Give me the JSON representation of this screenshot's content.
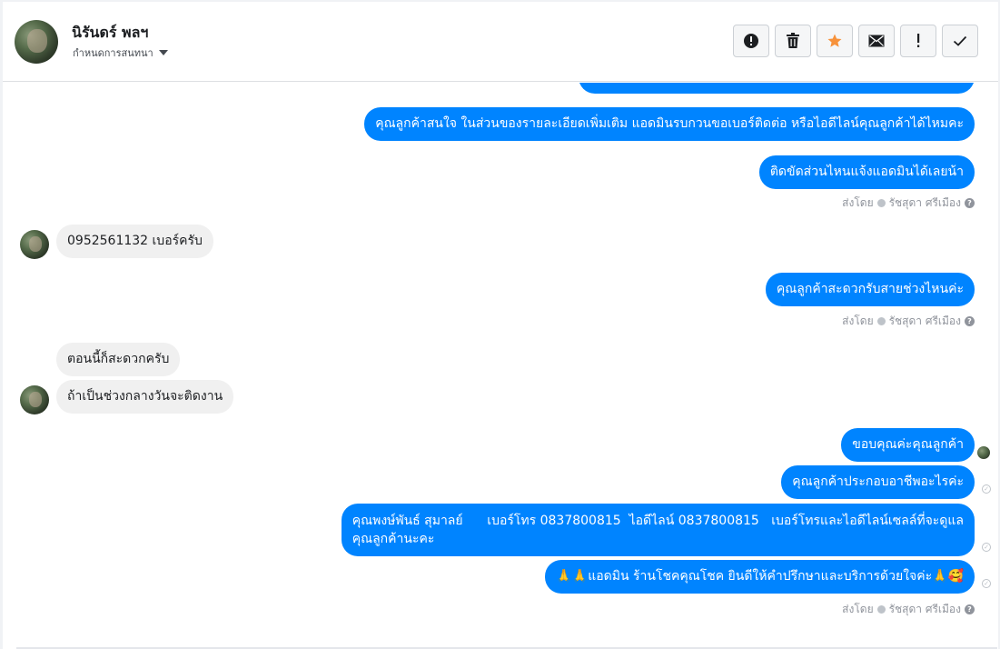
{
  "header": {
    "contact_name": "นิรันดร์ พลฯ",
    "set_conversation_label": "กำหนดการสนทนา",
    "actions": [
      {
        "name": "mark-spam-button",
        "icon": "alert-circle-icon"
      },
      {
        "name": "delete-button",
        "icon": "trash-icon"
      },
      {
        "name": "star-button",
        "icon": "star-icon"
      },
      {
        "name": "mark-unread-button",
        "icon": "envelope-icon"
      },
      {
        "name": "follow-up-button",
        "icon": "exclamation-icon"
      },
      {
        "name": "mark-done-button",
        "icon": "checkmark-icon"
      }
    ]
  },
  "colors": {
    "outgoing_bubble": "#0084ff",
    "incoming_bubble": "#f0f0f0",
    "star_color": "#f7923b"
  },
  "messages": {
    "m1": "คุณลูกค้าสนใจ ในส่วนของรายละเอียดเพิ่มเติม แอดมินรบกวนขอเบอร์ติดต่อ หรือไอดีไลน์คุณลูกค้าได้ไหมคะ",
    "m2": "ติดขัดส่วนไหนแจ้งแอดมินได้เลยน้า",
    "sender1_prefix": "ส่งโดย",
    "sender1_name": "รัชสุดา ศรีเมือง",
    "m3": "0952561132 เบอร์ครับ",
    "m4": "คุณลูกค้าสะดวกรับสายช่วงไหนค่ะ",
    "sender2_prefix": "ส่งโดย",
    "sender2_name": "รัชสุดา ศรีเมือง",
    "m5": "ตอนนี้ก็สะดวกครับ",
    "m6": "ถ้าเป็นช่วงกลางวันจะติดงาน",
    "m7": "ขอบคุณค่ะคุณลูกค้า",
    "m8": "คุณลูกค้าประกอบอาชีพอะไรค่ะ",
    "m9_line1": "คุณพงษ์พันธ์ สุมาลย์      เบอร์โทร 0837800815  ไอดีไลน์ 0837800815   เบอร์โทรและไอดีไลน์เซลล์ที่จะดูแล",
    "m9_line2": "คุณลูกค้านะคะ",
    "m10": "🙏🙏แอดมิน ร้านโชคคุณโชค ยินดีให้คำปรึกษาและบริการด้วยใจค่ะ🙏🥰",
    "sender3_prefix": "ส่งโดย",
    "sender3_name": "รัชสุดา ศรีเมือง"
  }
}
